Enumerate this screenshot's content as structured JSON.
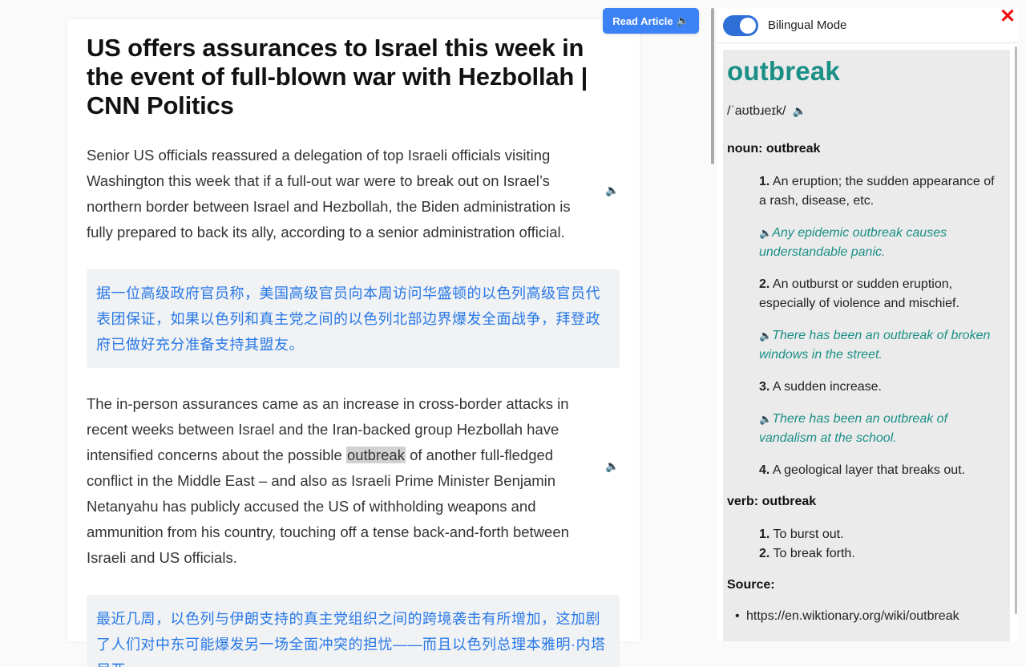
{
  "article": {
    "title": "US offers assurances to Israel this week in the event of full-blown war with Hezbollah | CNN Politics",
    "paragraphs": [
      {
        "text": "Senior US officials reassured a delegation of top Israeli officials visiting Washington this week that if a full-out war were to break out on Israel’s northern border between Israel and Hezbollah, the Biden administration is fully prepared to back its ally, according to a senior administration official.",
        "translation": "据一位高级政府官员称，美国高级官员向本周访问华盛顿的以色列高级官员代表团保证，如果以色列和真主党之间的以色列北部边界爆发全面战争，拜登政府已做好充分准备支持其盟友。"
      },
      {
        "text_before": "The in-person assurances came as an increase in cross-border attacks in recent weeks between Israel and the Iran-backed group Hezbollah have intensified concerns about the possible ",
        "highlight": "outbreak",
        "text_after": " of another full-fledged conflict in the Middle East – and also as Israeli Prime Minister Benjamin Netanyahu has publicly accused the US of withholding weapons and ammunition from his country, touching off a tense back-and-forth between Israeli and US officials.",
        "translation": "最近几周，以色列与伊朗支持的真主党组织之间的跨境袭击有所增加，这加剧了人们对中东可能爆发另一场全面冲突的担忧——而且以色列总理本雅明·内塔尼亚"
      }
    ],
    "speaker_icon": "🔈"
  },
  "toolbar": {
    "read_label": "Read Article",
    "read_icon": "🔈"
  },
  "panel": {
    "toggle_label": "Bilingual Mode",
    "toggle_on": true,
    "close_icon": "✕",
    "accent_color": "#1a8f86",
    "word": "outbreak",
    "phonetic": "/ˈaʊtbɹeɪk/",
    "speaker_icon": "🔈",
    "noun_header": "noun: outbreak",
    "noun_defs": [
      {
        "num": "1.",
        "text": "An eruption; the sudden appearance of a rash, disease, etc.",
        "example": "Any epidemic outbreak causes understandable panic."
      },
      {
        "num": "2.",
        "text": "An outburst or sudden eruption, especially of violence and mischief.",
        "example": "There has been an outbreak of broken windows in the street."
      },
      {
        "num": "3.",
        "text": "A sudden increase.",
        "example": "There has been an outbreak of vandalism at the school."
      },
      {
        "num": "4.",
        "text": "A geological layer that breaks out.",
        "example": ""
      }
    ],
    "verb_header": "verb: outbreak",
    "verb_defs": [
      {
        "num": "1.",
        "text": "To burst out."
      },
      {
        "num": "2.",
        "text": "To break forth."
      }
    ],
    "source_header": "Source:",
    "source_url": "https://en.wiktionary.org/wiki/outbreak"
  }
}
